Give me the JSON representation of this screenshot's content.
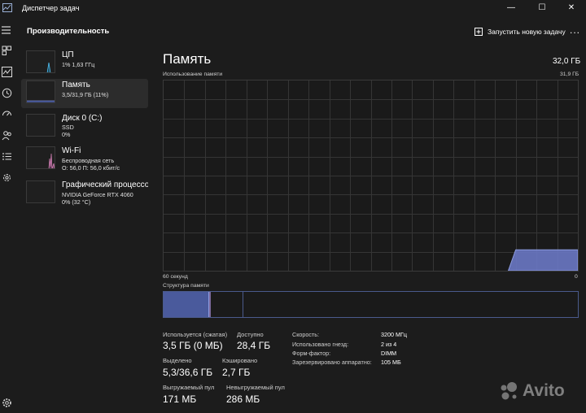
{
  "window": {
    "title": "Диспетчер задач",
    "controls": {
      "minimize": "—",
      "maximize": "☐",
      "close": "✕"
    }
  },
  "toolbar": {
    "title": "Производительность",
    "run_new_task": "Запустить новую задачу",
    "more": "..."
  },
  "nav_icons": [
    "hamburger-icon",
    "processes-icon",
    "performance-icon",
    "history-icon",
    "startup-icon",
    "users-icon",
    "details-icon",
    "services-icon",
    "settings-icon"
  ],
  "sidebar": {
    "items": [
      {
        "name": "ЦП",
        "line1": "1% 1,63 ГГц",
        "line2": "",
        "accent": "#4fc3f7"
      },
      {
        "name": "Память",
        "line1": "3,5/31,9 ГБ (11%)",
        "line2": "",
        "accent": "#7986cb"
      },
      {
        "name": "Диск 0 (C:)",
        "line1": "SSD",
        "line2": "0%",
        "accent": "#81c784"
      },
      {
        "name": "Wi-Fi",
        "line1": "Беспроводная сеть",
        "line2": "О: 56,0 П: 56,0 кбит/с",
        "accent": "#d17fb4"
      },
      {
        "name": "Графический процессор",
        "line1": "NVIDIA GeForce RTX 4060",
        "line2": "0% (32 °C)",
        "accent": "#b388c8"
      }
    ]
  },
  "main": {
    "title": "Память",
    "total": "32,0 ГБ",
    "usage_label": "Использование памяти",
    "usage_max": "31,9 ГБ",
    "time_label": "60 секунд",
    "zero_label": "0",
    "composition_label": "Структура памяти",
    "usage_fraction": 0.11,
    "composition": {
      "in_use": 0.111,
      "modified": 0.002,
      "standby": 0.08,
      "free": 0.807
    },
    "stats": {
      "in_use_label": "Используется (сжатая)",
      "in_use_value": "3,5 ГБ (0 МБ)",
      "available_label": "Доступно",
      "available_value": "28,4 ГБ",
      "committed_label": "Выделено",
      "committed_value": "5,3/36,6 ГБ",
      "cached_label": "Кэшировано",
      "cached_value": "2,7 ГБ",
      "paged_label": "Выгружаемый пул",
      "paged_value": "171 МБ",
      "nonpaged_label": "Невыгружаемый пул",
      "nonpaged_value": "286 МБ"
    },
    "info": {
      "speed_label": "Скорость:",
      "speed_value": "3200 МГц",
      "slots_label": "Использовано гнезд:",
      "slots_value": "2 из 4",
      "form_label": "Форм-фактор:",
      "form_value": "DIMM",
      "reserved_label": "Зарезервировано аппаратно:",
      "reserved_value": "105 МБ"
    }
  },
  "watermark": {
    "text": "Avito"
  },
  "colors": {
    "memory": "#7986cb",
    "background": "#1c1c1c",
    "grid": "#353535"
  }
}
